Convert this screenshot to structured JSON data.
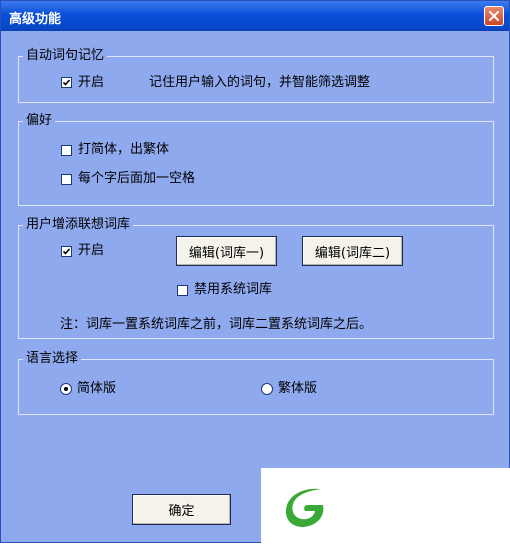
{
  "window": {
    "title": "高级功能"
  },
  "group_memory": {
    "legend": "自动词句记忆",
    "enable_label": "开启",
    "enable_checked": true,
    "description": "记住用户输入的词句，并智能筛选调整"
  },
  "group_pref": {
    "legend": "偏好",
    "simp_trad_label": "打简体，出繁体",
    "simp_trad_checked": false,
    "space_label": "每个字后面加一空格",
    "space_checked": false
  },
  "group_dict": {
    "legend": "用户增添联想词库",
    "enable_label": "开启",
    "enable_checked": true,
    "edit1_label": "编辑(词库一)",
    "edit2_label": "编辑(词库二)",
    "disable_sys_label": "禁用系统词库",
    "disable_sys_checked": false,
    "note": "注：词库一置系统词库之前，词库二置系统词库之后。"
  },
  "group_lang": {
    "legend": "语言选择",
    "simplified_label": "简体版",
    "traditional_label": "繁体版",
    "selected": "简体版"
  },
  "ok_label": "确定",
  "colors": {
    "window_bg": "#8fa9ee",
    "titlebar": "#0a4fd8",
    "close": "#c9442a",
    "logo_green": "#3aa935"
  }
}
